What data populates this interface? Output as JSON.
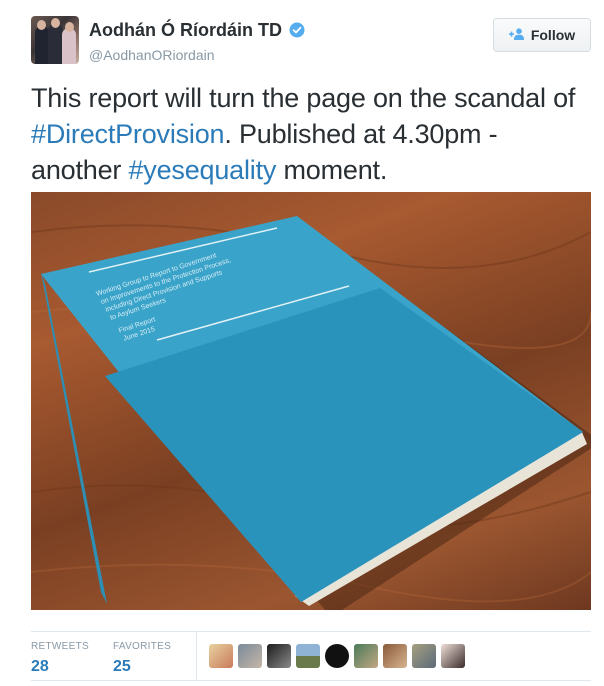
{
  "header": {
    "display_name": "Aodhán Ó Ríordáin TD",
    "handle": "@AodhanORiordain",
    "follow_label": "Follow",
    "verified_color": "#55acee"
  },
  "tweet": {
    "text_1": "This report will turn the page on the scandal of ",
    "hashtag_1": "#DirectProvision",
    "text_2": ". Published at 4.30pm - another ",
    "hashtag_2": "#yesequality",
    "text_3": " moment."
  },
  "media": {
    "cover_text": "Working Group to Report to Government on Improvements to the Protection Process, including Direct Provision and Supports to Asylum Seekers",
    "cover_sub_1": "Final Report",
    "cover_sub_2": "June 2015"
  },
  "stats": {
    "retweets_label": "RETWEETS",
    "retweets_value": "28",
    "favorites_label": "FAVORITES",
    "favorites_value": "25"
  },
  "colors": {
    "link": "#2b7bb9",
    "text": "#292f33",
    "muted": "#8899a6"
  }
}
